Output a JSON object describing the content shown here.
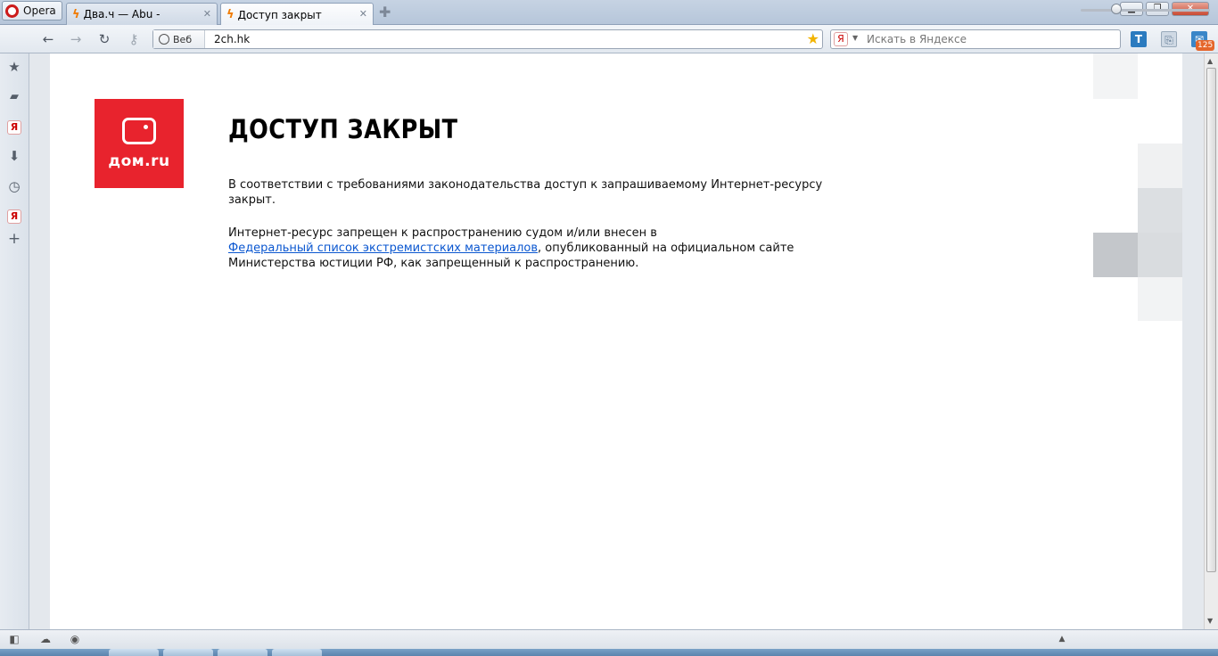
{
  "browser": {
    "menu_label": "Opera",
    "tabs": [
      {
        "title": "Два.ч — Abu -",
        "active": false
      },
      {
        "title": "Доступ закрыт",
        "active": true
      }
    ],
    "address": {
      "web_label": "Веб",
      "url": "2ch.hk"
    },
    "search": {
      "engine_icon": "Я",
      "placeholder": "Искать в Яндексе"
    },
    "badge_count": "125"
  },
  "page": {
    "logo_text": "дом.ru",
    "headline": "ДОСТУП ЗАКРЫТ",
    "paragraph1": "В соответствии с требованиями законодательства доступ к запрашиваемому Интернет-ресурсу закрыт.",
    "paragraph2_before": "Интернет-ресурс запрещен к распространению судом и/или внесен в",
    "paragraph2_link": "Федеральный список экстремистских материалов",
    "paragraph2_after": ", опубликованный на официальном сайте Министерства юстиции РФ, как запрещенный к распространению.",
    "brand_color": "#e8232d",
    "link_color": "#0b57d0"
  }
}
